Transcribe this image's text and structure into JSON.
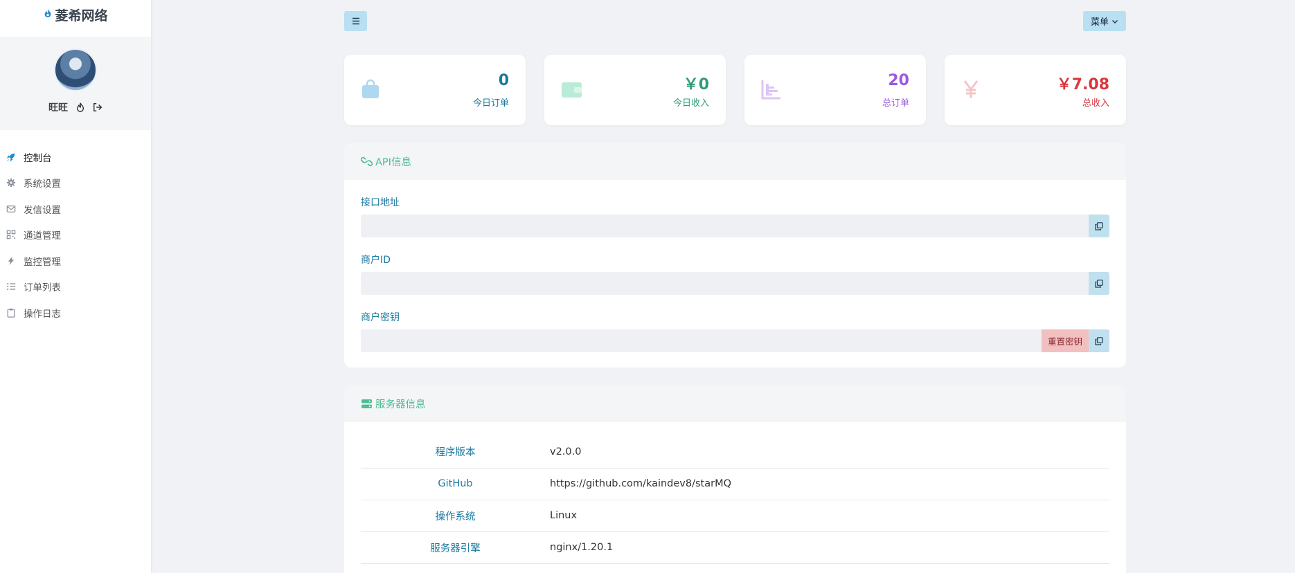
{
  "brand": {
    "name": "菱希网络"
  },
  "profile": {
    "username": "旺旺"
  },
  "nav": [
    {
      "label": "控制台",
      "icon": "rocket-icon"
    },
    {
      "label": "系统设置",
      "icon": "gear-icon"
    },
    {
      "label": "发信设置",
      "icon": "envelope-icon"
    },
    {
      "label": "通道管理",
      "icon": "qrcode-icon"
    },
    {
      "label": "监控管理",
      "icon": "bolt-icon"
    },
    {
      "label": "订单列表",
      "icon": "list-icon"
    },
    {
      "label": "操作日志",
      "icon": "clipboard-icon"
    }
  ],
  "topbar": {
    "menu_label": "菜单"
  },
  "stats": [
    {
      "value": "0",
      "label": "今日订单",
      "color": "#1a7aa0",
      "icon": "shopping-bag-icon"
    },
    {
      "value": "￥0",
      "label": "今日收入",
      "color": "#2e9d78",
      "icon": "wallet-icon"
    },
    {
      "value": "20",
      "label": "总订单",
      "color": "#9b59e0",
      "icon": "bar-chart-icon"
    },
    {
      "value": "￥7.08",
      "label": "总收入",
      "color": "#d9363e",
      "icon": "yen-icon"
    }
  ],
  "api": {
    "title": "API信息",
    "fields": [
      {
        "label": "接口地址",
        "value": ""
      },
      {
        "label": "商户ID",
        "value": ""
      },
      {
        "label": "商户密钥",
        "value": "",
        "reset_label": "重置密钥"
      }
    ]
  },
  "server": {
    "title": "服务器信息",
    "rows": [
      {
        "key": "程序版本",
        "value": "v2.0.0"
      },
      {
        "key": "GitHub",
        "value": "https://github.com/kaindev8/starMQ"
      },
      {
        "key": "操作系统",
        "value": "Linux"
      },
      {
        "key": "服务器引擎",
        "value": "nginx/1.20.1"
      }
    ]
  }
}
